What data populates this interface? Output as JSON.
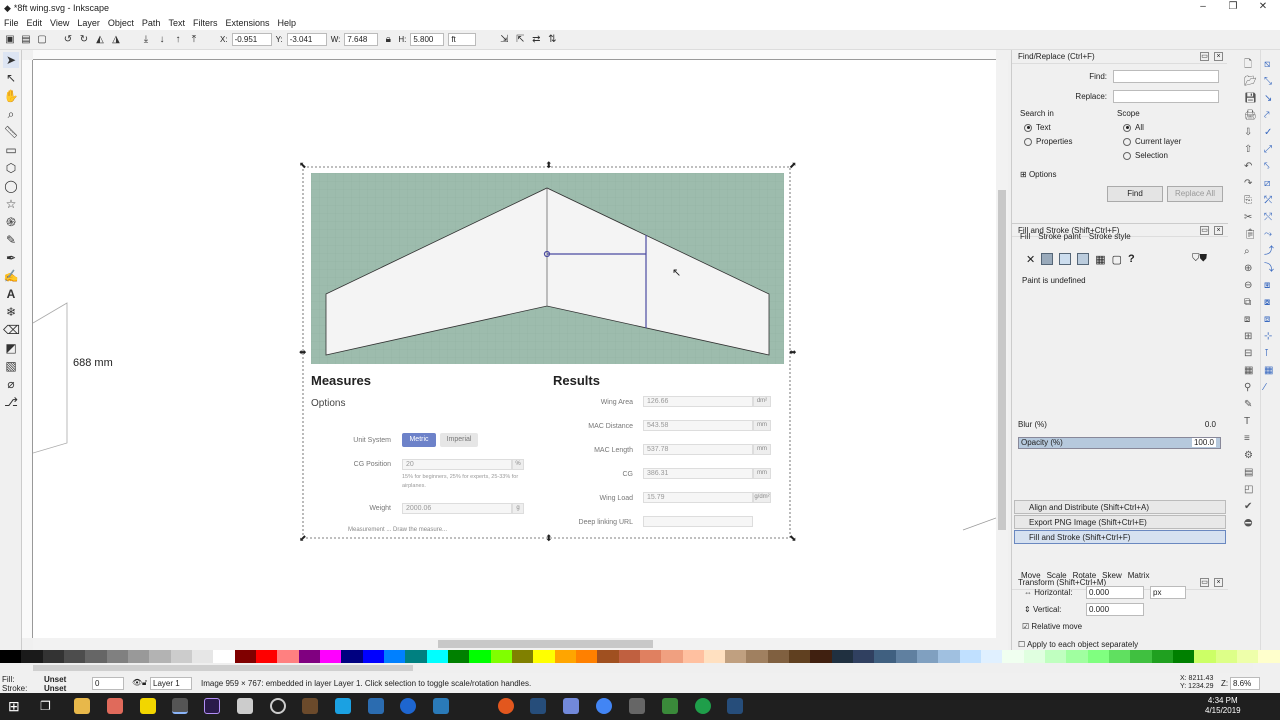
{
  "window": {
    "title": "*8ft wing.svg - Inkscape",
    "controls": [
      "–",
      "❐",
      "✕"
    ]
  },
  "menu": [
    "File",
    "Edit",
    "View",
    "Layer",
    "Object",
    "Path",
    "Text",
    "Filters",
    "Extensions",
    "Help"
  ],
  "toolbar": {
    "x_label": "X:",
    "x_value": "-0.951",
    "y_label": "Y:",
    "y_value": "-3.041",
    "w_label": "W:",
    "w_value": "7.648",
    "h_label": "H:",
    "h_value": "5.800",
    "unit": "ft"
  },
  "canvas": {
    "dimension_label": "688 mm",
    "image": {
      "measures_title": "Measures",
      "options_title": "Options",
      "results_title": "Results",
      "unit_system_label": "Unit System",
      "metric": "Metric",
      "imperial": "Imperial",
      "cg_position_label": "CG Position",
      "cg_position_value": "20",
      "cg_unit": "%",
      "cg_hint": "15% for beginners, 25% for experts, 25-33% for airplanes.",
      "weight_label": "Weight",
      "weight_value": "2000.06",
      "weight_unit": "g",
      "bottom_text": "Measurement ...  Draw the measure...",
      "results": [
        {
          "label": "Wing Area",
          "value": "126.66",
          "unit": "dm²"
        },
        {
          "label": "MAC Distance",
          "value": "543.58",
          "unit": "mm"
        },
        {
          "label": "MAC Length",
          "value": "537.78",
          "unit": "mm"
        },
        {
          "label": "CG",
          "value": "386.31",
          "unit": "mm"
        },
        {
          "label": "Wing Load",
          "value": "15.79",
          "unit": "g/dm²"
        },
        {
          "label": "Deep linking URL",
          "value": "",
          "unit": ""
        }
      ]
    }
  },
  "find_replace": {
    "title": "Find/Replace (Ctrl+F)",
    "find_label": "Find:",
    "replace_label": "Replace:",
    "search_in_label": "Search in",
    "search_text": "Text",
    "search_properties": "Properties",
    "scope_label": "Scope",
    "scope_all": "All",
    "scope_layer": "Current layer",
    "scope_selection": "Selection",
    "options_label": "Options",
    "find_button": "Find",
    "replace_all_button": "Replace All"
  },
  "fill_stroke": {
    "title": "Fill and Stroke (Shift+Ctrl+F)",
    "tab_fill": "Fill",
    "tab_stroke_paint": "Stroke paint",
    "tab_stroke_style": "Stroke style",
    "status": "Paint is undefined",
    "blur_label": "Blur (%)",
    "blur_value": "0.0",
    "opacity_label": "Opacity (%)",
    "opacity_value": "100.0"
  },
  "collapsed_panels": [
    "Align and Distribute (Shift+Ctrl+A)",
    "Export PNG Image (Shift+Ctrl+E)",
    "Fill and Stroke (Shift+Ctrl+F)"
  ],
  "transform": {
    "title": "Transform (Shift+Ctrl+M)",
    "tabs": [
      "Move",
      "Scale",
      "Rotate",
      "Skew",
      "Matrix"
    ],
    "horizontal_label": "Horizontal:",
    "horizontal_value": "0.000",
    "vertical_label": "Vertical:",
    "vertical_value": "0.000",
    "unit": "px",
    "relative_move": "Relative move",
    "apply_each": "Apply to each object separately"
  },
  "status": {
    "fill_label": "Fill:",
    "stroke_label": "Stroke:",
    "fill_value": "Unset",
    "stroke_value": "Unset",
    "opacity_value": "0",
    "layer": "Layer 1",
    "message": "Image 959 × 767: embedded in layer Layer 1. Click selection to toggle scale/rotation handles.",
    "cursor_x": "X: 8211.43",
    "cursor_y": "Y: 1234.29",
    "zoom_label": "Z:",
    "zoom": "8.6%"
  },
  "clock": {
    "time": "4:34 PM",
    "date": "4/15/2019"
  }
}
